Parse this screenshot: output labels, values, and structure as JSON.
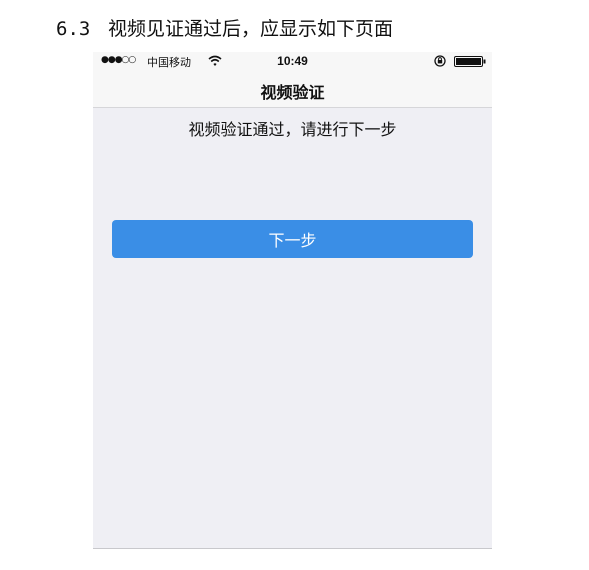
{
  "document": {
    "section_number": "6.3",
    "section_title": "视频见证通过后，应显示如下页面"
  },
  "status_bar": {
    "signal": "●●●○○",
    "carrier": "中国移动",
    "time": "10:49",
    "icons": [
      "signal-dots-icon",
      "wifi-icon",
      "orientation-lock-icon",
      "battery-icon"
    ]
  },
  "nav": {
    "title": "视频验证"
  },
  "content": {
    "message": "视频验证通过，请进行下一步",
    "next_button_label": "下一步"
  },
  "colors": {
    "page_background": "#efeff4",
    "nav_background": "#f7f7f7",
    "primary_button": "#3a8ee6",
    "button_text": "#ffffff"
  }
}
